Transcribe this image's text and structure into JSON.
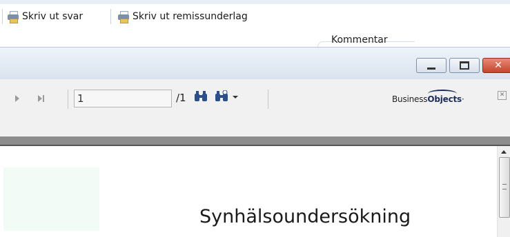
{
  "toolbar": {
    "print_answer_label": "Skriv ut svar",
    "print_referral_label": "Skriv ut remissunderlag",
    "print_answer_icon": "printer-icon",
    "print_referral_icon": "printer-icon"
  },
  "tabs": {
    "comment_label": "Kommentar"
  },
  "window": {
    "close_color": "#c3452d",
    "close_glyph": "✕"
  },
  "viewer": {
    "page_input_value": "1",
    "page_total": "/1",
    "find_icon": "binoculars-icon",
    "search_icon": "binoculars-plus-icon",
    "logo_prefix": "Business",
    "logo_suffix": "Objects",
    "logo_tm": "·",
    "close_glyph": "✕"
  },
  "document": {
    "title": "Synhälsoundersökning"
  }
}
